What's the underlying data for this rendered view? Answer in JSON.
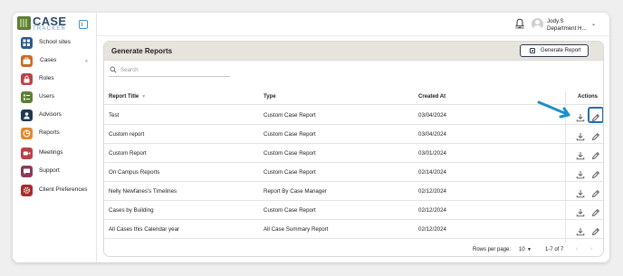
{
  "app": {
    "logo_top": "CASE",
    "logo_bottom": "TRACKER"
  },
  "sidebar": {
    "items": [
      {
        "label": "School sites",
        "icon": "school-grid-icon",
        "color": "#2c5a8a"
      },
      {
        "label": "Cases",
        "icon": "briefcase-icon",
        "color": "#c86a28",
        "has_submenu": true
      },
      {
        "label": "Roles",
        "icon": "lock-icon",
        "color": "#b8454a"
      },
      {
        "label": "Users",
        "icon": "users-list-icon",
        "color": "#5f7f36"
      },
      {
        "label": "Advisors",
        "icon": "advisor-icon",
        "color": "#22384f"
      },
      {
        "label": "Reports",
        "icon": "reports-icon",
        "color": "#e08a2c",
        "active": true
      },
      {
        "label": "Meetings",
        "icon": "video-icon",
        "color": "#b84248"
      },
      {
        "label": "Support",
        "icon": "chat-icon",
        "color": "#8a3a5c"
      },
      {
        "label": "Client Preferences",
        "icon": "settings-icon",
        "color": "#a62d2d"
      }
    ]
  },
  "topbar": {
    "user_name": "Jody.S",
    "user_role": "Department H..."
  },
  "page": {
    "title": "Generate Reports",
    "generate_button_label": "Generate Report",
    "search_placeholder": "Search"
  },
  "table": {
    "headers": {
      "title": "Report Title",
      "type": "Type",
      "created": "Created At",
      "actions": "Actions"
    },
    "rows": [
      {
        "title": "Test",
        "type": "Custom Case Report",
        "created": "03/04/2024"
      },
      {
        "title": "Custom report",
        "type": "Custom Case Report",
        "created": "03/04/2024"
      },
      {
        "title": "Custom Report",
        "type": "Custom Case Report",
        "created": "03/01/2024"
      },
      {
        "title": "On Campus Reports",
        "type": "Custom Case Report",
        "created": "02/14/2024"
      },
      {
        "title": "Nelly Newfanes's Timelines",
        "type": "Report By Case Manager",
        "created": "02/12/2024"
      },
      {
        "title": "Cases by Building",
        "type": "Custom Case Report",
        "created": "02/12/2024"
      },
      {
        "title": "All Cases this Calendar year",
        "type": "All Case Summary Report",
        "created": "02/12/2024"
      }
    ]
  },
  "pagination": {
    "rows_per_page_label": "Rows per page:",
    "rows_per_page": "10",
    "range": "1-7 of 7"
  },
  "colors": {
    "header_band": "#e7e4de",
    "accent_blue": "#1f6fb0",
    "callout_arrow": "#1e8fc8"
  }
}
